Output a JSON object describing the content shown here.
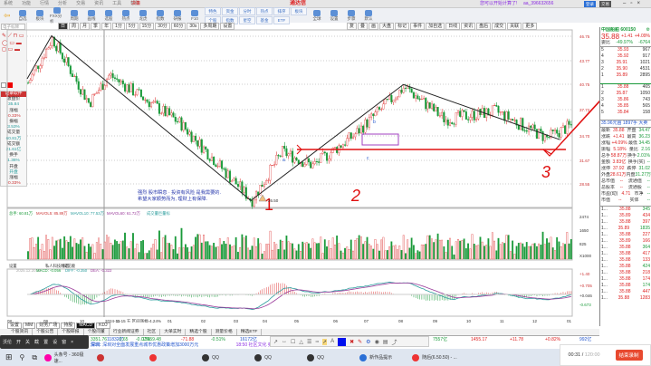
{
  "window": {
    "menus": [
      "系统",
      "功能",
      "行情",
      "分析",
      "交易",
      "资讯",
      "工具",
      "帮助"
    ],
    "app_title": "通达信",
    "center_tag": "决策",
    "app_name": "通达信",
    "user_msg": "您可以开始计算了!",
    "user_id": "aa_396632656",
    "btn_login": "登录",
    "btn_trade": "交易"
  },
  "toolbar": {
    "items": [
      "后退",
      "自选",
      "板块",
      "FXX分析",
      "周期",
      "画线",
      "选股",
      "热点",
      "龙虎",
      "指数",
      "研报",
      "F10",
      "全球",
      "设置",
      "步骤",
      "默认"
    ],
    "pairs": [
      "特色",
      "资金",
      "分时",
      "热点",
      "排序",
      "板块",
      "个股",
      "指数",
      "星空",
      "基金",
      "ETF"
    ]
  },
  "periods": [
    "日",
    "周",
    "月",
    "季",
    "年",
    "1分",
    "5分",
    "15分",
    "30分",
    "60分",
    "30s",
    "多周期",
    "设置"
  ],
  "chart_tools": [
    "复",
    "叠",
    "画",
    "大盘",
    "标记",
    "事件",
    "加自选",
    "日线",
    "资讯",
    "盘后",
    "成交",
    "关联",
    "更多"
  ],
  "left_panel": {
    "search_placeholder": "电子标牌",
    "records_label": "记录软件",
    "labels": [
      "收盘价",
      "涨幅",
      "振幅",
      "成交量",
      "成交额",
      "换手",
      "开盘",
      "涨幅"
    ],
    "values": [
      "35.84",
      "-0.33%",
      "3.53%",
      "60.81万",
      "21.61亿",
      "1.36%",
      "开盘",
      "-0.33%"
    ],
    "side": [
      "收盘",
      "分钟",
      "分价"
    ]
  },
  "price_axis": [
    "46.75",
    "43.77",
    "40.75",
    "37.72",
    "34.70",
    "31.67",
    "28.55"
  ],
  "volume_axis": [
    "2474",
    "1650",
    "825",
    "X1000"
  ],
  "macd_axis": [
    "+1.40",
    "+0.705",
    "+0.046",
    "-0.673"
  ],
  "date_axis": [
    "08",
    "09",
    "10",
    "11",
    "2024-11-15 五 区间涨幅-4.24%",
    "01",
    "02",
    "03",
    "04",
    "05",
    "06",
    "07",
    "08",
    "09",
    "10",
    "11",
    "12",
    "01"
  ],
  "annotations": {
    "low_price": "26.50",
    "note_line1": "强烈 股市瞬息 · 投资有风险 是我需要的.",
    "note_line2": "希望大家顺势而为, 理财上有保障.",
    "marks": [
      "1",
      "2",
      "3"
    ],
    "points": [
      "a",
      "b",
      "c"
    ]
  },
  "volume_legend": {
    "turnover": "总手: 60.81万",
    "mavol5": "MAVOL5: 85.89万",
    "mavol10": "MAVOL10: 77.53万",
    "mavol60": "MAVOL60: 61.72万",
    "signal": "成交量巨量标"
  },
  "macd_legend": {
    "date": "2025.12.20.31",
    "macd": "MACD: -0.056",
    "diff": "DIFF: -0.350",
    "dea": "DEA: -0.322"
  },
  "indicator_tabs": [
    "设置",
    "MACD指标",
    "私人科技精选",
    "同花顺"
  ],
  "right_panel": {
    "stock": "中国船舶 600150",
    "price": "35.88",
    "change": "+1.41",
    "pct": "+4.09%",
    "weibi_label": "委比",
    "weibi": "-49.97%",
    "weicha": "-6764",
    "sell": [
      [
        "5",
        "35.93",
        "967"
      ],
      [
        "4",
        "35.92",
        "917"
      ],
      [
        "3",
        "35.91",
        "1021"
      ],
      [
        "2",
        "35.90",
        "4531"
      ],
      [
        "1",
        "35.89",
        "2895"
      ]
    ],
    "buy": [
      [
        "1",
        "35.88",
        "465"
      ],
      [
        "2",
        "35.87",
        "1050"
      ],
      [
        "3",
        "35.86",
        "743"
      ],
      [
        "4",
        "35.85",
        "565"
      ],
      [
        "5",
        "35.84",
        "158"
      ]
    ],
    "sell_label": "卖盘",
    "buy_label": "买盘",
    "summary": "35.96元亩 1897手 大卖",
    "stats": [
      [
        "最新",
        "35.88",
        "开盘",
        "34.47"
      ],
      [
        "涨跌",
        "+1.41",
        "最高",
        "36.23"
      ],
      [
        "涨幅",
        "+4.09%",
        "最低",
        "34.45"
      ],
      [
        "振幅",
        "5.18%",
        "量比",
        "2.16"
      ],
      [
        "总手",
        "58.87万",
        "换手",
        "2.01%"
      ],
      [
        "金额",
        "3.83亿",
        "换手(实)",
        "--"
      ],
      [
        "涨停",
        "37.92",
        "跌停",
        "31.02"
      ],
      [
        "外盘",
        "28.61万",
        "内盘",
        "31.27万"
      ],
      [
        "总市值",
        "--",
        "流通值",
        "--"
      ],
      [
        "总股本",
        "--",
        "流通股",
        "--"
      ],
      [
        "市盈(动)",
        "4.71",
        "市净",
        "--"
      ],
      [
        "市值",
        "--",
        "实体",
        "--"
      ]
    ],
    "ticks": [
      [
        "1...",
        "35.88",
        "345"
      ],
      [
        "1...",
        "35.89",
        "434"
      ],
      [
        "1...",
        "35.88",
        "397"
      ],
      [
        "1...",
        "35.89",
        "1835"
      ],
      [
        "1...",
        "35.88",
        "227"
      ],
      [
        "1...",
        "35.89",
        "166"
      ],
      [
        "1...",
        "35.88",
        "364"
      ],
      [
        "1...",
        "35.88",
        "417"
      ],
      [
        "1...",
        "35.88",
        "133"
      ],
      [
        "1...",
        "35.88",
        "424"
      ],
      [
        "1...",
        "35.88",
        "218"
      ],
      [
        "1...",
        "35.88",
        "174"
      ],
      [
        "1...",
        "35.88",
        "174"
      ],
      [
        "1...",
        "35.88",
        "447"
      ],
      [
        "1...",
        "35.88",
        "1283"
      ]
    ]
  },
  "bottom_tabs": [
    "设置",
    "MM",
    "财务广场",
    "持股",
    "MACD",
    "KDJ"
  ],
  "sub_tabs": [
    "个股资讯",
    "个股公告",
    "个股研报",
    "个股问董",
    "行业新闻证券",
    "社区",
    "大单实时",
    "精选个股",
    "测量价格",
    "精选ETF"
  ],
  "index_row": {
    "sh": "3351.76",
    "sh_chg": "-2.65",
    "sh_pct": "-0.07%",
    "sh_amt": "11832亿",
    "sz": "13959.48",
    "sz_chg": "-71.88",
    "sz_pct": "-0.51%",
    "sz_amt": "16172亿",
    "cy": "7557亿",
    "cy_val": "1455.17",
    "cy_chg": "+11.78",
    "cy_pct": "+0.82%",
    "cy_amt": "992亿"
  },
  "news": {
    "label": "深圳:",
    "text": "深圳对全面发展重点城市优惠政策增加3000万元",
    "text2": "18:50 社区文化 奥运运动员冠军 约20人届时"
  },
  "float_bar": [
    "沃伦",
    "开",
    "关",
    "截",
    "置",
    "设",
    "窗",
    "×"
  ],
  "taskbar": {
    "apps": [
      "头条号 - 360极速...",
      "",
      "",
      "QQ",
      "QQ",
      "QQ",
      "新作品提示",
      "随后(6.50.50) - ..."
    ]
  },
  "recorder": {
    "time": "00:31",
    "total": "120:00",
    "stop": "结束录制"
  },
  "chart_data": {
    "type": "candlestick",
    "key_prices": [
      {
        "t": 0,
        "p": 41.0
      },
      {
        "t": 12,
        "p": 46.5
      },
      {
        "t": 30,
        "p": 38.5
      },
      {
        "t": 40,
        "p": 42
      },
      {
        "t": 75,
        "p": 36
      },
      {
        "t": 110,
        "p": 26.5
      },
      {
        "t": 125,
        "p": 32.5
      },
      {
        "t": 140,
        "p": 30.8
      },
      {
        "t": 160,
        "p": 34.5
      },
      {
        "t": 185,
        "p": 40.5
      },
      {
        "t": 205,
        "p": 36.5
      },
      {
        "t": 230,
        "p": 37.5
      },
      {
        "t": 255,
        "p": 34.2
      },
      {
        "t": 268,
        "p": 35.88
      }
    ],
    "ylim": [
      28.55,
      46.75
    ],
    "zigzag": [
      {
        "t": 0,
        "p": 41.5
      },
      {
        "t": 12,
        "p": 46.8
      },
      {
        "t": 110,
        "p": 26.5
      },
      {
        "t": 185,
        "p": 40.8
      },
      {
        "t": 262,
        "p": 34.0
      }
    ]
  },
  "colors": {
    "up": "#e04040",
    "down": "#1a9a3a",
    "zigzag": "#222222",
    "annotation": "#e01010"
  }
}
